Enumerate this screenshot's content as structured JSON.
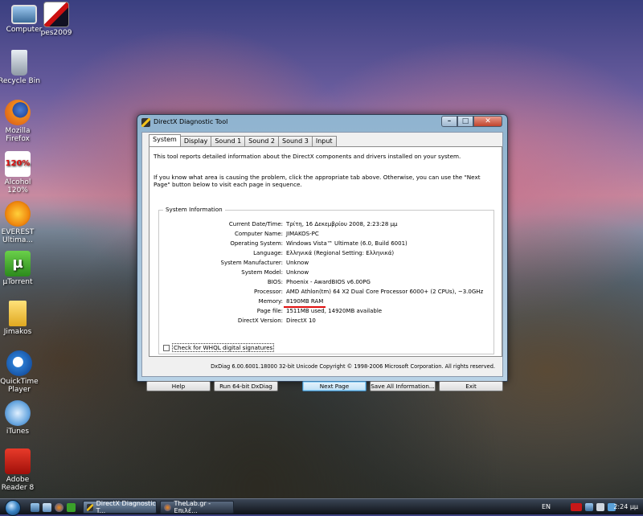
{
  "desktop": {
    "icons": [
      {
        "label": "Computer"
      },
      {
        "label": "pes2009"
      },
      {
        "label": "Recycle Bin"
      },
      {
        "label": "Mozilla Firefox"
      },
      {
        "label": "Alcohol 120%"
      },
      {
        "label": "EVEREST Ultima..."
      },
      {
        "label": "µTorrent"
      },
      {
        "label": "Jimakos"
      },
      {
        "label": "QuickTime Player"
      },
      {
        "label": "iTunes"
      },
      {
        "label": "Adobe Reader 8"
      }
    ],
    "icon_glyphs": {
      "alcohol": "120%",
      "utorrent": "µ"
    }
  },
  "window": {
    "title": "DirectX Diagnostic Tool",
    "controls": {
      "minimize": "–",
      "maximize": "□",
      "close": "✕"
    },
    "tabs": [
      "System",
      "Display",
      "Sound 1",
      "Sound 2",
      "Sound 3",
      "Input"
    ],
    "active_tab": "System",
    "intro1": "This tool reports detailed information about the DirectX components and drivers installed on your system.",
    "intro2": "If you know what area is causing the problem, click the appropriate tab above.  Otherwise, you can use the \"Next Page\" button below to visit each page in sequence.",
    "group_title": "System Information",
    "rows": [
      {
        "label": "Current Date/Time:",
        "value": "Τρίτη, 16 Δεκεμβρίου 2008, 2:23:28 μμ"
      },
      {
        "label": "Computer Name:",
        "value": "JIMAKOS-PC"
      },
      {
        "label": "Operating System:",
        "value": "Windows Vista™ Ultimate (6.0, Build 6001)"
      },
      {
        "label": "Language:",
        "value": "Ελληνικά (Regional Setting: Ελληνικά)"
      },
      {
        "label": "System Manufacturer:",
        "value": "Unknow"
      },
      {
        "label": "System Model:",
        "value": "Unknow"
      },
      {
        "label": "BIOS:",
        "value": "Phoenix - AwardBIOS v6.00PG"
      },
      {
        "label": "Processor:",
        "value": "AMD Athlon(tm) 64 X2 Dual Core Processor 6000+ (2 CPUs), ~3.0GHz"
      },
      {
        "label": "Memory:",
        "value": "8190MB RAM"
      },
      {
        "label": "Page file:",
        "value": "1511MB used, 14920MB available"
      },
      {
        "label": "DirectX Version:",
        "value": "DirectX 10"
      }
    ],
    "checkbox_label": "Check for WHQL digital signatures",
    "checkbox_checked": false,
    "footer": "DxDiag 6.00.6001.18000 32-bit Unicode  Copyright © 1998-2006 Microsoft Corporation.  All rights reserved.",
    "buttons": {
      "help": "Help",
      "run64": "Run 64-bit DxDiag",
      "next": "Next Page",
      "save": "Save All Information...",
      "exit": "Exit"
    }
  },
  "taskbar": {
    "items": [
      {
        "label": "DirectX Diagnostic T..."
      },
      {
        "label": "TheLab.gr - Επιλέ..."
      }
    ],
    "language": "EN",
    "clock": "2:24 μμ"
  },
  "colors": {
    "highlight_underline": "#e01010",
    "default_button": "#3c7fb1"
  }
}
